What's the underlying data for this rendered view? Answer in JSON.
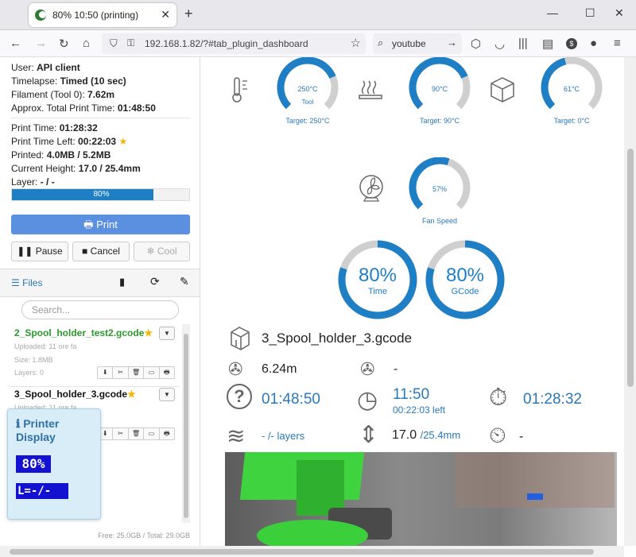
{
  "browser": {
    "tab_title": "80% 10:50 (printing)",
    "url": "192.168.1.82/?#tab_plugin_dashboard",
    "search_value": "youtube"
  },
  "state": {
    "user_label": "User:",
    "user_value": "API client",
    "timelapse_label": "Timelapse:",
    "timelapse_value": "Timed (10 sec)",
    "filament_label": "Filament (Tool 0):",
    "filament_value": "7.62m",
    "approx_label": "Approx. Total Print Time:",
    "approx_value": "01:48:50",
    "print_time_label": "Print Time:",
    "print_time_value": "01:28:32",
    "time_left_label": "Print Time Left:",
    "time_left_value": "00:22:03",
    "printed_label": "Printed:",
    "printed_value": "4.0MB / 5.2MB",
    "height_label": "Current Height:",
    "height_value": "17.0 / 25.4mm",
    "layer_label": "Layer:",
    "layer_value": "- / -",
    "progress_text": "80%",
    "progress": 0.8
  },
  "controls": {
    "print_label": "Print",
    "pause_label": "Pause",
    "cancel_label": "Cancel",
    "cool_label": "Cool"
  },
  "files": {
    "header": "Files",
    "search_placeholder": "Search...",
    "items": [
      {
        "name": "2_Spool_holder_test2.gcode",
        "uploaded": "Uploaded: 11 ore fa",
        "size": "Size: 1.8MB",
        "layers": "Layers: 0"
      },
      {
        "name": "3_Spool_holder_3.gcode",
        "uploaded": "Uploaded: 11 ore fa"
      }
    ],
    "free_text": "Free: 25.0GB / Total: 29.0GB"
  },
  "printer_display": {
    "title": "Printer Display",
    "line1": "80%",
    "line2": "L=-/-"
  },
  "dashboard": {
    "tool": {
      "value": "250°C",
      "label": "Tool",
      "target": "Target: 250°C",
      "fraction": 0.75
    },
    "bed": {
      "value": "90°C",
      "target": "Target: 90°C",
      "fraction": 0.75
    },
    "chamber": {
      "value": "61°C",
      "target": "Target: 0°C",
      "fraction": 0.45
    },
    "fan": {
      "value": "57%",
      "label": "Fan Speed",
      "fraction": 0.57
    },
    "time_progress": {
      "value": "80%",
      "label": "Time",
      "fraction": 0.8
    },
    "gcode_progress": {
      "value": "80%",
      "label": "GCode",
      "fraction": 0.8
    },
    "filename": "3_Spool_holder_3.gcode",
    "filament_used": "6.24m",
    "filament_other": "-",
    "total_time": "01:48:50",
    "eta": "11:50",
    "eta_left": "00:22:03 left",
    "elapsed": "01:28:32",
    "layers": "- /- layers",
    "height": "17.0",
    "height_total": "/25.4mm",
    "layer_time": "-"
  },
  "colors": {
    "accent": "#1f7fc4",
    "track": "#cfcfcf",
    "print_button": "#5b8fe0",
    "lcd": "#1212d0",
    "panel": "#d8edf8"
  }
}
